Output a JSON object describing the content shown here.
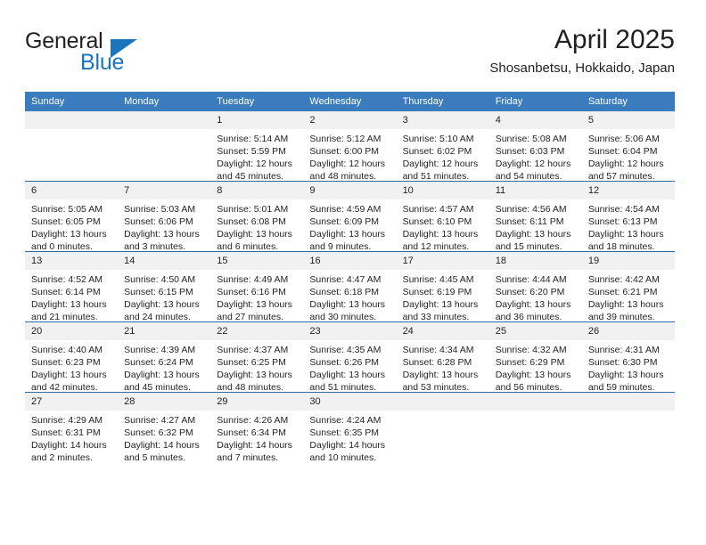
{
  "logo": {
    "word1": "General",
    "word2": "Blue",
    "triangle_icon": "blue-triangle-icon",
    "brand_color": "#1b75bc"
  },
  "header": {
    "title": "April 2025",
    "subtitle": "Shosanbetsu, Hokkaido, Japan"
  },
  "theme": {
    "header_bg": "#3a7cbe",
    "row_separator": "#2a6ca8",
    "daynum_bg": "#f1f1f1",
    "text": "#231f20"
  },
  "weekdays": [
    "Sunday",
    "Monday",
    "Tuesday",
    "Wednesday",
    "Thursday",
    "Friday",
    "Saturday"
  ],
  "weeks": [
    [
      {
        "day": "",
        "empty": true
      },
      {
        "day": "",
        "empty": true
      },
      {
        "day": "1",
        "sunrise": "Sunrise: 5:14 AM",
        "sunset": "Sunset: 5:59 PM",
        "daylight": "Daylight: 12 hours and 45 minutes."
      },
      {
        "day": "2",
        "sunrise": "Sunrise: 5:12 AM",
        "sunset": "Sunset: 6:00 PM",
        "daylight": "Daylight: 12 hours and 48 minutes."
      },
      {
        "day": "3",
        "sunrise": "Sunrise: 5:10 AM",
        "sunset": "Sunset: 6:02 PM",
        "daylight": "Daylight: 12 hours and 51 minutes."
      },
      {
        "day": "4",
        "sunrise": "Sunrise: 5:08 AM",
        "sunset": "Sunset: 6:03 PM",
        "daylight": "Daylight: 12 hours and 54 minutes."
      },
      {
        "day": "5",
        "sunrise": "Sunrise: 5:06 AM",
        "sunset": "Sunset: 6:04 PM",
        "daylight": "Daylight: 12 hours and 57 minutes."
      }
    ],
    [
      {
        "day": "6",
        "sunrise": "Sunrise: 5:05 AM",
        "sunset": "Sunset: 6:05 PM",
        "daylight": "Daylight: 13 hours and 0 minutes."
      },
      {
        "day": "7",
        "sunrise": "Sunrise: 5:03 AM",
        "sunset": "Sunset: 6:06 PM",
        "daylight": "Daylight: 13 hours and 3 minutes."
      },
      {
        "day": "8",
        "sunrise": "Sunrise: 5:01 AM",
        "sunset": "Sunset: 6:08 PM",
        "daylight": "Daylight: 13 hours and 6 minutes."
      },
      {
        "day": "9",
        "sunrise": "Sunrise: 4:59 AM",
        "sunset": "Sunset: 6:09 PM",
        "daylight": "Daylight: 13 hours and 9 minutes."
      },
      {
        "day": "10",
        "sunrise": "Sunrise: 4:57 AM",
        "sunset": "Sunset: 6:10 PM",
        "daylight": "Daylight: 13 hours and 12 minutes."
      },
      {
        "day": "11",
        "sunrise": "Sunrise: 4:56 AM",
        "sunset": "Sunset: 6:11 PM",
        "daylight": "Daylight: 13 hours and 15 minutes."
      },
      {
        "day": "12",
        "sunrise": "Sunrise: 4:54 AM",
        "sunset": "Sunset: 6:13 PM",
        "daylight": "Daylight: 13 hours and 18 minutes."
      }
    ],
    [
      {
        "day": "13",
        "sunrise": "Sunrise: 4:52 AM",
        "sunset": "Sunset: 6:14 PM",
        "daylight": "Daylight: 13 hours and 21 minutes."
      },
      {
        "day": "14",
        "sunrise": "Sunrise: 4:50 AM",
        "sunset": "Sunset: 6:15 PM",
        "daylight": "Daylight: 13 hours and 24 minutes."
      },
      {
        "day": "15",
        "sunrise": "Sunrise: 4:49 AM",
        "sunset": "Sunset: 6:16 PM",
        "daylight": "Daylight: 13 hours and 27 minutes."
      },
      {
        "day": "16",
        "sunrise": "Sunrise: 4:47 AM",
        "sunset": "Sunset: 6:18 PM",
        "daylight": "Daylight: 13 hours and 30 minutes."
      },
      {
        "day": "17",
        "sunrise": "Sunrise: 4:45 AM",
        "sunset": "Sunset: 6:19 PM",
        "daylight": "Daylight: 13 hours and 33 minutes."
      },
      {
        "day": "18",
        "sunrise": "Sunrise: 4:44 AM",
        "sunset": "Sunset: 6:20 PM",
        "daylight": "Daylight: 13 hours and 36 minutes."
      },
      {
        "day": "19",
        "sunrise": "Sunrise: 4:42 AM",
        "sunset": "Sunset: 6:21 PM",
        "daylight": "Daylight: 13 hours and 39 minutes."
      }
    ],
    [
      {
        "day": "20",
        "sunrise": "Sunrise: 4:40 AM",
        "sunset": "Sunset: 6:23 PM",
        "daylight": "Daylight: 13 hours and 42 minutes."
      },
      {
        "day": "21",
        "sunrise": "Sunrise: 4:39 AM",
        "sunset": "Sunset: 6:24 PM",
        "daylight": "Daylight: 13 hours and 45 minutes."
      },
      {
        "day": "22",
        "sunrise": "Sunrise: 4:37 AM",
        "sunset": "Sunset: 6:25 PM",
        "daylight": "Daylight: 13 hours and 48 minutes."
      },
      {
        "day": "23",
        "sunrise": "Sunrise: 4:35 AM",
        "sunset": "Sunset: 6:26 PM",
        "daylight": "Daylight: 13 hours and 51 minutes."
      },
      {
        "day": "24",
        "sunrise": "Sunrise: 4:34 AM",
        "sunset": "Sunset: 6:28 PM",
        "daylight": "Daylight: 13 hours and 53 minutes."
      },
      {
        "day": "25",
        "sunrise": "Sunrise: 4:32 AM",
        "sunset": "Sunset: 6:29 PM",
        "daylight": "Daylight: 13 hours and 56 minutes."
      },
      {
        "day": "26",
        "sunrise": "Sunrise: 4:31 AM",
        "sunset": "Sunset: 6:30 PM",
        "daylight": "Daylight: 13 hours and 59 minutes."
      }
    ],
    [
      {
        "day": "27",
        "sunrise": "Sunrise: 4:29 AM",
        "sunset": "Sunset: 6:31 PM",
        "daylight": "Daylight: 14 hours and 2 minutes."
      },
      {
        "day": "28",
        "sunrise": "Sunrise: 4:27 AM",
        "sunset": "Sunset: 6:32 PM",
        "daylight": "Daylight: 14 hours and 5 minutes."
      },
      {
        "day": "29",
        "sunrise": "Sunrise: 4:26 AM",
        "sunset": "Sunset: 6:34 PM",
        "daylight": "Daylight: 14 hours and 7 minutes."
      },
      {
        "day": "30",
        "sunrise": "Sunrise: 4:24 AM",
        "sunset": "Sunset: 6:35 PM",
        "daylight": "Daylight: 14 hours and 10 minutes."
      },
      {
        "day": "",
        "empty": true
      },
      {
        "day": "",
        "empty": true
      },
      {
        "day": "",
        "empty": true
      }
    ]
  ]
}
